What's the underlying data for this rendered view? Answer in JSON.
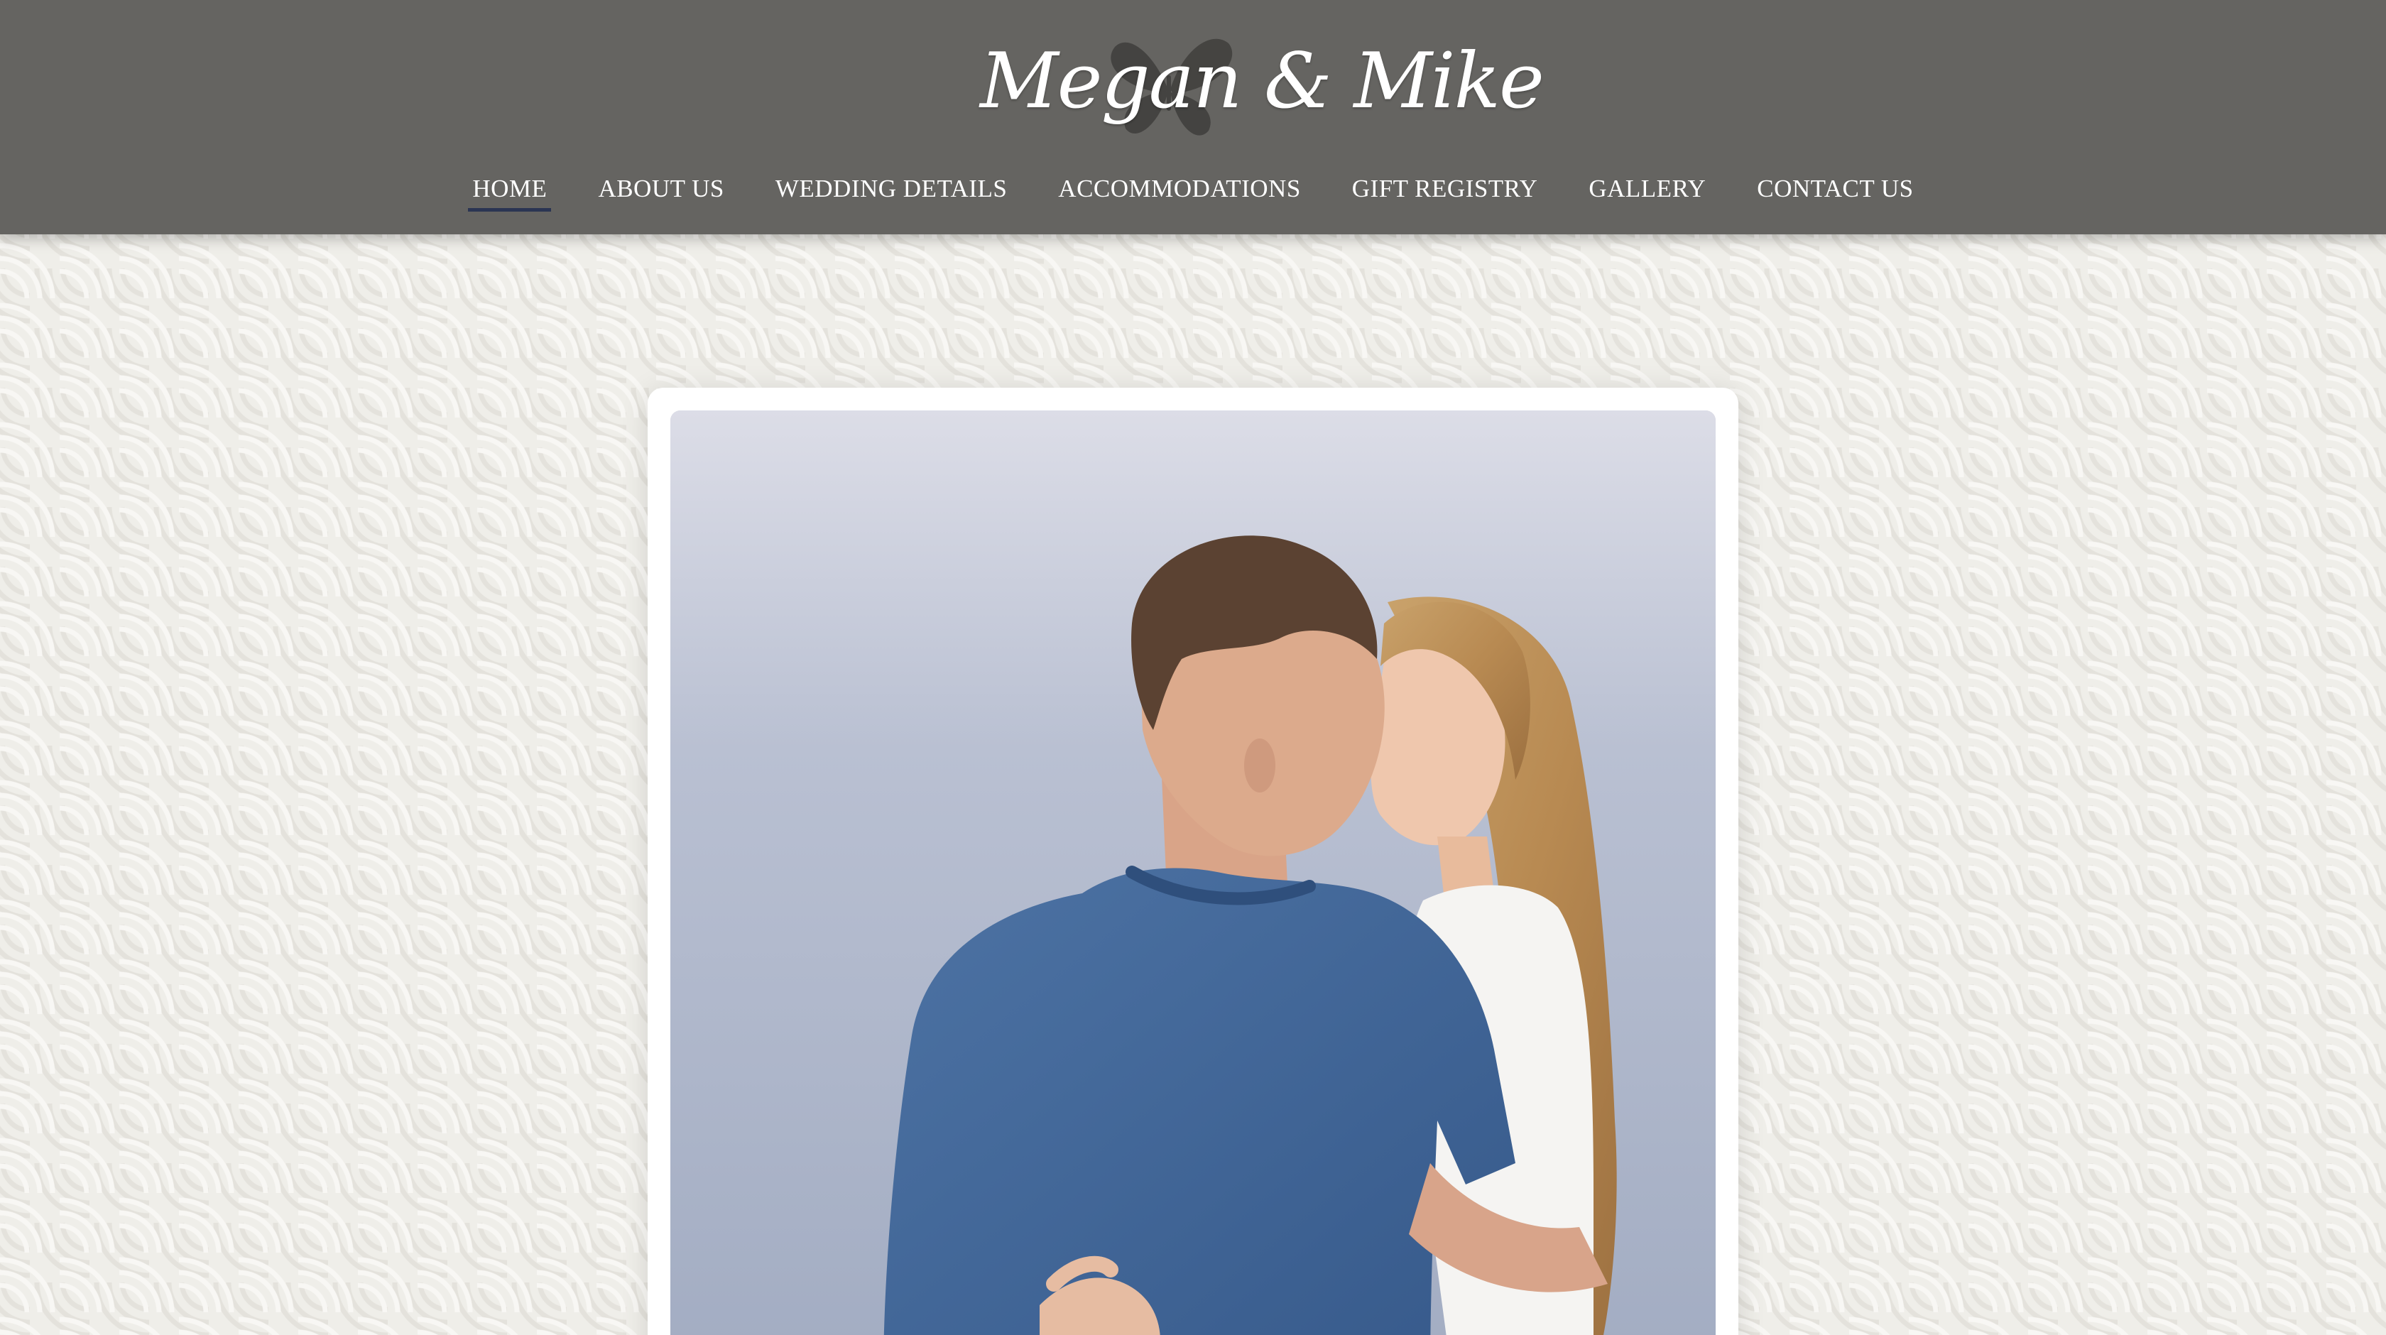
{
  "site": {
    "logo_text": "Megan & Mike",
    "logo_icon": "butterfly-icon"
  },
  "nav": {
    "items": [
      {
        "label": "HOME",
        "active": true
      },
      {
        "label": "ABOUT US",
        "active": false
      },
      {
        "label": "WEDDING DETAILS",
        "active": false
      },
      {
        "label": "ACCOMMODATIONS",
        "active": false
      },
      {
        "label": "GIFT REGISTRY",
        "active": false
      },
      {
        "label": "GALLERY",
        "active": false
      },
      {
        "label": "CONTACT US",
        "active": false
      }
    ]
  },
  "colors": {
    "header_bg": "#656461",
    "nav_text": "#ffffff",
    "active_underline": "#2b3553",
    "page_bg": "#efeee9",
    "card_bg": "#ffffff"
  },
  "hero": {
    "image_icon": "couple-photo"
  }
}
